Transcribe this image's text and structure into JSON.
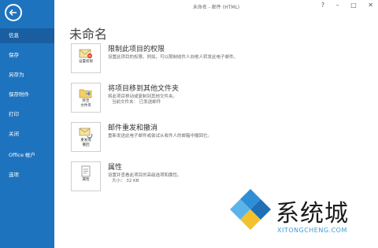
{
  "window": {
    "title": "未命名 - 邮件 (HTML)",
    "controls": [
      "?",
      "–",
      "□",
      "✕"
    ]
  },
  "sidebar": {
    "items": [
      {
        "label": "信息",
        "active": true
      },
      {
        "label": "保存"
      },
      {
        "label": "另存为"
      },
      {
        "label": "保存附件"
      },
      {
        "label": "打印"
      },
      {
        "label": "关闭"
      },
      {
        "label": "Office 帐户"
      },
      {
        "label": "选项"
      }
    ]
  },
  "main": {
    "title": "未命名",
    "sections": [
      {
        "tile_label": "设置权限",
        "title": "限制此项目的权限",
        "description": "设置此项目的权限，例如，可以限制收件人向他人转发此电子邮件。"
      },
      {
        "tile_label": "移至\n文件夹",
        "title": "将项目移到其他文件夹",
        "description": "将此项目移动或复制到其他文件夹。",
        "meta": "当前文件夹：  已发送邮件"
      },
      {
        "tile_label": "重发或\n撤回",
        "title": "邮件重发和撤消",
        "description": "重新发送此电子邮件或尝试从收件人的邮箱中撤回它。"
      },
      {
        "tile_label": "属性",
        "title": "属性",
        "description": "设置并查看此项目的高级选项和属性。",
        "meta": "大小：  32 KB"
      }
    ]
  },
  "watermark": {
    "text": "系统城",
    "url": "XITONGCHENG.COM"
  },
  "colors": {
    "sidebar": "#1e73be",
    "active_item": "#195ea0",
    "watermark_blue": "#3a9bd8"
  }
}
